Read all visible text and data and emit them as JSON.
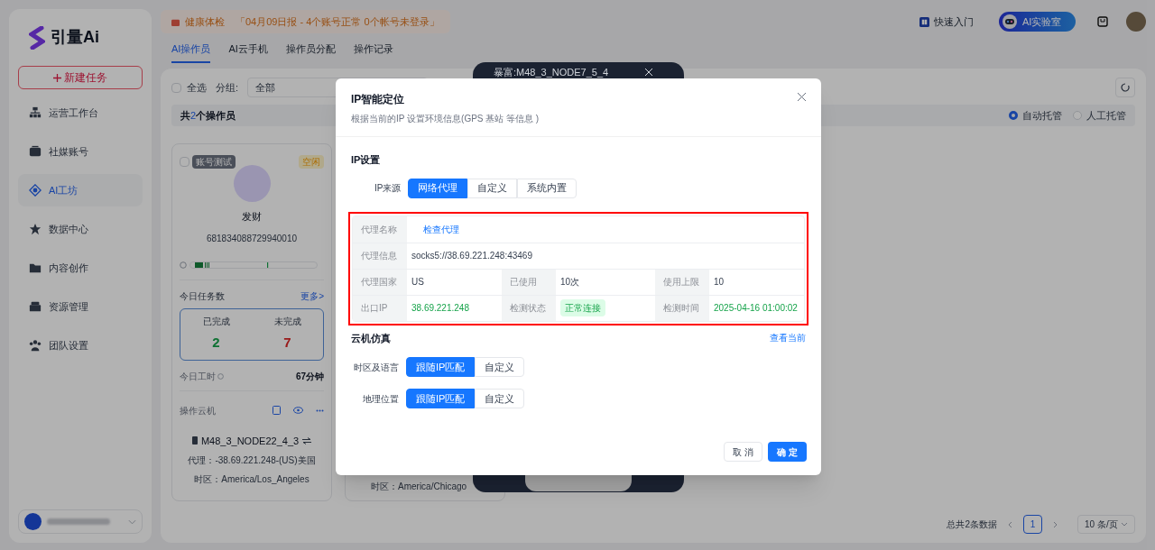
{
  "sidebar": {
    "logo_text": "引量Ai",
    "new_task_button": "新建任务",
    "items": [
      {
        "label": "运营工作台",
        "selected": false
      },
      {
        "label": "社媒账号",
        "selected": false
      },
      {
        "label": "AI工坊",
        "selected": true
      },
      {
        "label": "数据中心",
        "selected": false
      },
      {
        "label": "内容创作",
        "selected": false
      },
      {
        "label": "资源管理",
        "selected": false
      },
      {
        "label": "团队设置",
        "selected": false
      }
    ]
  },
  "header": {
    "health_label": "健康体检",
    "health_report": "「04月09日报 - 4个账号正常 0个帐号未登录」",
    "quick_start": "快速入门",
    "ai_lab": "AI实验室"
  },
  "tabs": [
    {
      "label": "AI操作员",
      "selected": true
    },
    {
      "label": "AI云手机",
      "selected": false
    },
    {
      "label": "操作员分配",
      "selected": false
    },
    {
      "label": "操作记录",
      "selected": false
    }
  ],
  "filter": {
    "select_all": {
      "label": "全选",
      "checked": false
    },
    "group_label": "分组:",
    "group_value": "全部"
  },
  "summary": {
    "prefix": "共",
    "count": "2",
    "suffix": "个操作员"
  },
  "hosting": [
    {
      "label": "自动托管",
      "selected": true
    },
    {
      "label": "人工托管",
      "selected": false
    }
  ],
  "operator_card": {
    "checked": false,
    "tag": "账号测试",
    "status": "空闲",
    "name": "发财",
    "id": "681834088729940010",
    "tasks_title": "今日任务数",
    "more_link": "更多>",
    "task_stats": [
      {
        "label": "已完成",
        "value": "2",
        "kind": "done"
      },
      {
        "label": "未完成",
        "value": "7",
        "kind": "pending"
      }
    ],
    "work_time_label": "今日工时",
    "work_time_value": "67分钟",
    "cloud_title": "操作云机",
    "device": "M48_3_NODE22_4_3",
    "proxy": "代理：-38.69.221.248-(US)美国",
    "timezone": "时区：America/Los_Angeles"
  },
  "second_card": {
    "timezone": "时区：America/Chicago"
  },
  "phone_window": {
    "title": "暴富:M48_3_NODE7_5_4"
  },
  "pagination": {
    "total": "总共2条数据",
    "pages": [
      {
        "label": "1",
        "selected": true
      }
    ],
    "page_size": "10 条/页"
  },
  "modal": {
    "title": "IP智能定位",
    "subtitle": "根据当前的IP 设置环境信息(GPS 基站 等信息 )",
    "ip_section": "IP设置",
    "ip_source_label": "IP来源",
    "ip_source_options": [
      {
        "label": "网络代理",
        "selected": true
      },
      {
        "label": "自定义",
        "selected": false
      },
      {
        "label": "系统内置",
        "selected": false
      }
    ],
    "proxy_rows": [
      [
        {
          "label": "代理名称",
          "value": "检查代理",
          "kind": "link"
        }
      ],
      [
        {
          "label": "代理信息",
          "value": "socks5://38.69.221.248:43469",
          "kind": "text"
        }
      ],
      [
        {
          "label": "代理国家",
          "value": "US",
          "kind": "text"
        },
        {
          "label": "已使用",
          "value": "10次",
          "kind": "text"
        },
        {
          "label": "使用上限",
          "value": "10",
          "kind": "text"
        }
      ],
      [
        {
          "label": "出口IP",
          "value": "38.69.221.248",
          "kind": "success"
        },
        {
          "label": "检测状态",
          "value": "正常连接",
          "kind": "tag"
        },
        {
          "label": "检测时间",
          "value": "2025-04-16 01:00:02",
          "kind": "success"
        }
      ]
    ],
    "cloud_section": "云机仿真",
    "view_current": "查看当前",
    "settings": [
      {
        "label": "时区及语言",
        "options": [
          {
            "label": "跟随IP匹配",
            "selected": true
          },
          {
            "label": "自定义",
            "selected": false
          }
        ]
      },
      {
        "label": "地理位置",
        "options": [
          {
            "label": "跟随IP匹配",
            "selected": true
          },
          {
            "label": "自定义",
            "selected": false
          }
        ]
      }
    ],
    "cancel": "取 消",
    "confirm": "确 定"
  }
}
